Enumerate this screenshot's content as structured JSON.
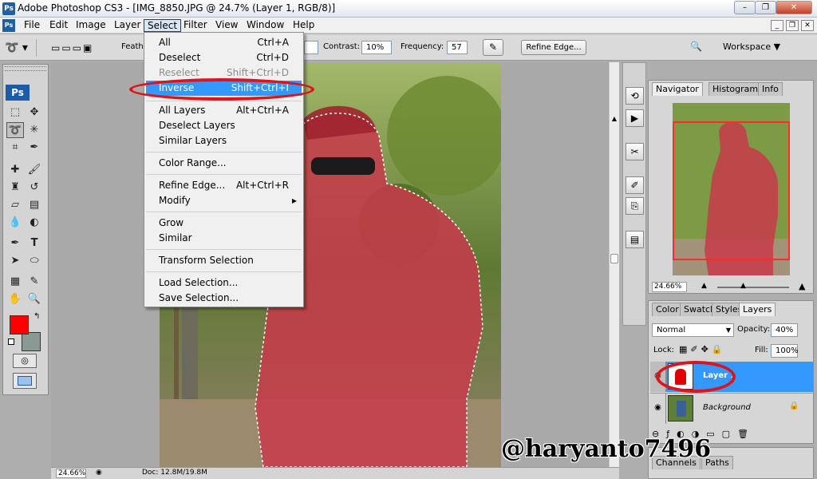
{
  "app": {
    "title": "Adobe Photoshop CS3 - [IMG_8850.JPG @ 24.7% (Layer 1, RGB/8)]",
    "icon": "Ps"
  },
  "window_controls": {
    "minimize": "–",
    "restore": "❐",
    "close": "✕"
  },
  "menu": [
    "File",
    "Edit",
    "Image",
    "Layer",
    "Select",
    "Filter",
    "View",
    "Window",
    "Help"
  ],
  "doc_controls": {
    "minimize": "_",
    "restore": "❐",
    "close": "✕"
  },
  "options": {
    "feather_label": "Feathe",
    "contrast_label": "Contrast:",
    "contrast_value": "10%",
    "frequency_label": "Frequency:",
    "frequency_value": "57",
    "refine_edge": "Refine Edge...",
    "workspace": "Workspace ▼"
  },
  "select_menu": {
    "items": [
      {
        "label": "All",
        "shortcut": "Ctrl+A"
      },
      {
        "label": "Deselect",
        "shortcut": "Ctrl+D"
      },
      {
        "label": "Reselect",
        "shortcut": "Shift+Ctrl+D",
        "disabled": true
      },
      {
        "label": "Inverse",
        "shortcut": "Shift+Ctrl+I",
        "highlighted": true
      },
      {
        "label": "All Layers",
        "shortcut": "Alt+Ctrl+A"
      },
      {
        "label": "Deselect Layers",
        "shortcut": ""
      },
      {
        "label": "Similar Layers",
        "shortcut": ""
      },
      {
        "label": "Color Range...",
        "shortcut": ""
      },
      {
        "label": "Refine Edge...",
        "shortcut": "Alt+Ctrl+R"
      },
      {
        "label": "Modify",
        "shortcut": "▸"
      },
      {
        "label": "Grow",
        "shortcut": ""
      },
      {
        "label": "Similar",
        "shortcut": ""
      },
      {
        "label": "Transform Selection",
        "shortcut": ""
      },
      {
        "label": "Load Selection...",
        "shortcut": ""
      },
      {
        "label": "Save Selection...",
        "shortcut": ""
      }
    ]
  },
  "toolbox": {
    "logo": "Ps"
  },
  "status": {
    "zoom": "24.66%",
    "doc": "Doc: 12.8M/19.8M"
  },
  "navigator": {
    "tabs": [
      "Navigator",
      "Histogram",
      "Info"
    ],
    "zoom": "24.66%"
  },
  "layers_panel": {
    "tabs": [
      "Color",
      "Swatch",
      "Styles",
      "Layers"
    ],
    "blend_mode": "Normal",
    "opacity_label": "Opacity:",
    "opacity": "40%",
    "lock_label": "Lock:",
    "fill_label": "Fill:",
    "fill": "100%",
    "layers": [
      {
        "name": "Layer 1",
        "selected": true
      },
      {
        "name": "Background",
        "selected": false
      }
    ]
  },
  "bottom_tabs": [
    "Channels",
    "Paths"
  ],
  "watermark": "@haryanto7496",
  "colors": {
    "foreground": "#ff0000",
    "background": "#8a9a93",
    "highlight": "#3399ff",
    "annotation": "#e2121a"
  }
}
